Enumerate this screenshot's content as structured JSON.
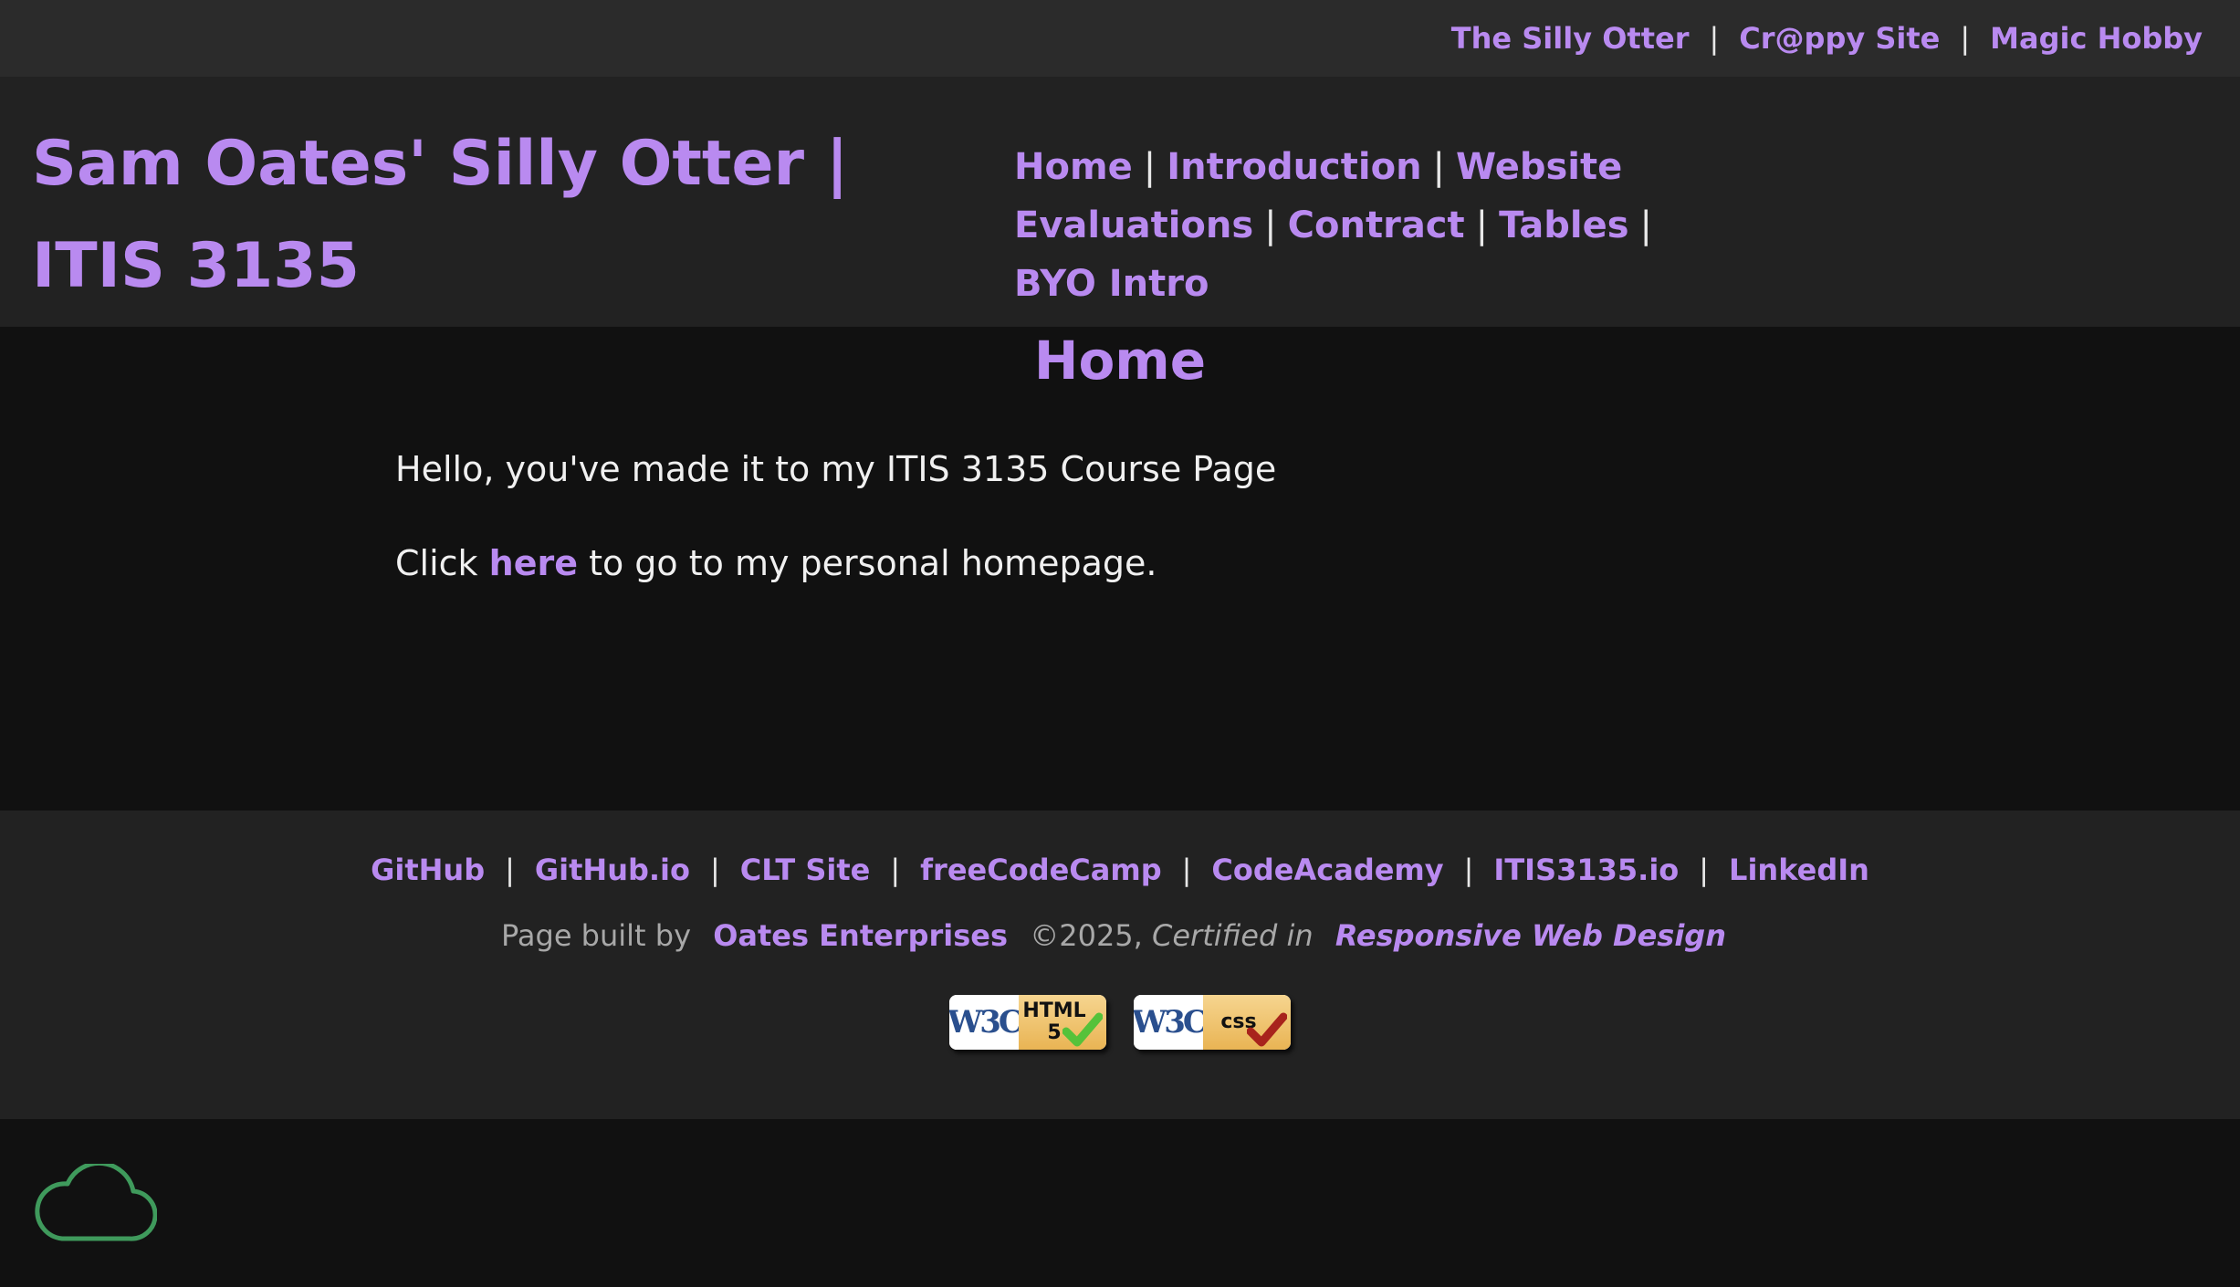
{
  "topbar": {
    "links": [
      "The Silly Otter",
      "Cr@ppy Site",
      "Magic Hobby"
    ],
    "separator": "|"
  },
  "header": {
    "title": "Sam Oates' Silly Otter | ITIS 3135",
    "nav": [
      "Home",
      "Introduction",
      "Website Evaluations",
      "Contract",
      "Tables",
      "BYO Intro"
    ]
  },
  "main": {
    "heading": "Home",
    "paragraph1": "Hello, you've made it to my ITIS 3135 Course Page",
    "paragraph2_before": "Click ",
    "paragraph2_link": "here",
    "paragraph2_after": " to go to my personal homepage."
  },
  "footer": {
    "links": [
      "GitHub",
      "GitHub.io",
      "CLT Site",
      "freeCodeCamp",
      "CodeAcademy",
      "ITIS3135.io",
      "LinkedIn"
    ],
    "credits_prefix": "Page built by",
    "company": "Oates Enterprises",
    "copyright": "©2025,",
    "certified": "Certified in",
    "certification": "Responsive Web Design",
    "badges": [
      {
        "left": "W3C",
        "right_line1": "HTML",
        "right_line2": "5",
        "check_color": "#55c23a"
      },
      {
        "left": "W3C",
        "right_line1": "css",
        "right_line2": "",
        "check_color": "#a8231c"
      }
    ]
  },
  "colors": {
    "accent": "#b98af0",
    "cloud": "#3f9a5c"
  },
  "icons": {
    "bottom": "cloud-icon"
  }
}
